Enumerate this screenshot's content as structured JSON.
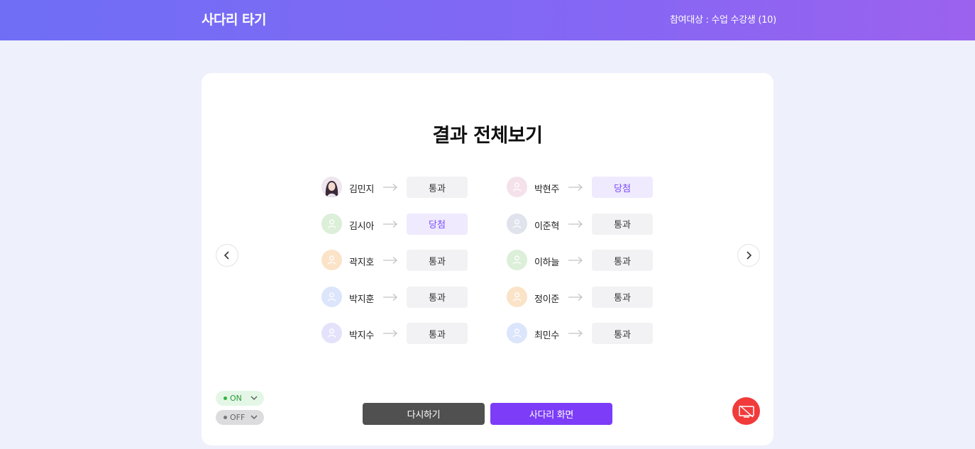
{
  "header": {
    "title": "사다리 타기",
    "participants": "참여대상 : 수업 수강생 (10)"
  },
  "main": {
    "title": "결과 전체보기",
    "left_column": [
      {
        "name": "김민지",
        "result": "통과",
        "status": "pass",
        "avatar": "photo",
        "avatar_color": "#5a3b7a"
      },
      {
        "name": "김시아",
        "result": "당첨",
        "status": "win",
        "avatar": "user-icon",
        "avatar_color": "#dcefd9"
      },
      {
        "name": "곽지호",
        "result": "통과",
        "status": "pass",
        "avatar": "user-icon",
        "avatar_color": "#fbe3c8"
      },
      {
        "name": "박지훈",
        "result": "통과",
        "status": "pass",
        "avatar": "user-icon",
        "avatar_color": "#dbe5fb"
      },
      {
        "name": "박지수",
        "result": "통과",
        "status": "pass",
        "avatar": "user-icon",
        "avatar_color": "#e4e2fb"
      }
    ],
    "right_column": [
      {
        "name": "박현주",
        "result": "당첨",
        "status": "win",
        "avatar": "user-icon",
        "avatar_color": "#f4e1ea"
      },
      {
        "name": "이준혁",
        "result": "통과",
        "status": "pass",
        "avatar": "user-icon",
        "avatar_color": "#e0e3ec"
      },
      {
        "name": "이하늘",
        "result": "통과",
        "status": "pass",
        "avatar": "user-icon",
        "avatar_color": "#dcefd9"
      },
      {
        "name": "정이준",
        "result": "통과",
        "status": "pass",
        "avatar": "user-icon",
        "avatar_color": "#fbe3c8"
      },
      {
        "name": "최민수",
        "result": "통과",
        "status": "pass",
        "avatar": "user-icon",
        "avatar_color": "#dbe5fb"
      }
    ]
  },
  "controls": {
    "toggle_on_label": "ON",
    "toggle_off_label": "OFF",
    "retry_label": "다시하기",
    "ladder_label": "사다리 화면"
  },
  "colors": {
    "accent": "#7c3cf8",
    "header_gradient_start": "#6f6ef5",
    "header_gradient_end": "#9b62ee",
    "record": "#f13b3b"
  },
  "icons": [
    "chevron-left-icon",
    "chevron-right-icon",
    "arrow-right-icon",
    "user-icon",
    "chevron-down-icon",
    "screen-off-icon"
  ]
}
